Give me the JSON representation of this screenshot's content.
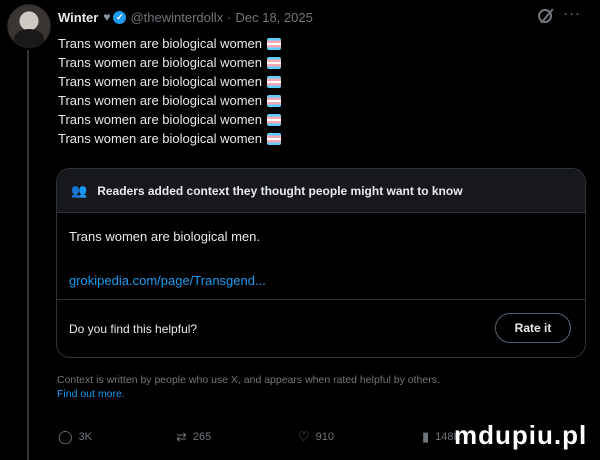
{
  "tweet": {
    "author_name": "Winter",
    "handle": "@thewinterdollx",
    "separator": "·",
    "date": "Dec 18, 2025",
    "lines": [
      "Trans women are biological women",
      "Trans women are biological women",
      "Trans women are biological women",
      "Trans women are biological women",
      "Trans women are biological women",
      "Trans women are biological women"
    ],
    "line_emoji": "transgender-flag"
  },
  "note": {
    "header": "Readers added context they thought people might want to know",
    "body": "Trans women are biological men.",
    "link": "grokipedia.com/page/Transgend...",
    "helpful_question": "Do you find this helpful?",
    "rate_label": "Rate it"
  },
  "disclaimer": {
    "text": "Context is written by people who use X, and appears when rated helpful by others.",
    "find_out": "Find out more."
  },
  "actions": {
    "replies": "3K",
    "reposts": "265",
    "likes": "910",
    "views": "148K"
  },
  "watermark": "mdupiu.pl",
  "colors": {
    "background": "#000000",
    "accent": "#1d9bf0",
    "muted": "#71767b",
    "text": "#e7e9ea"
  }
}
